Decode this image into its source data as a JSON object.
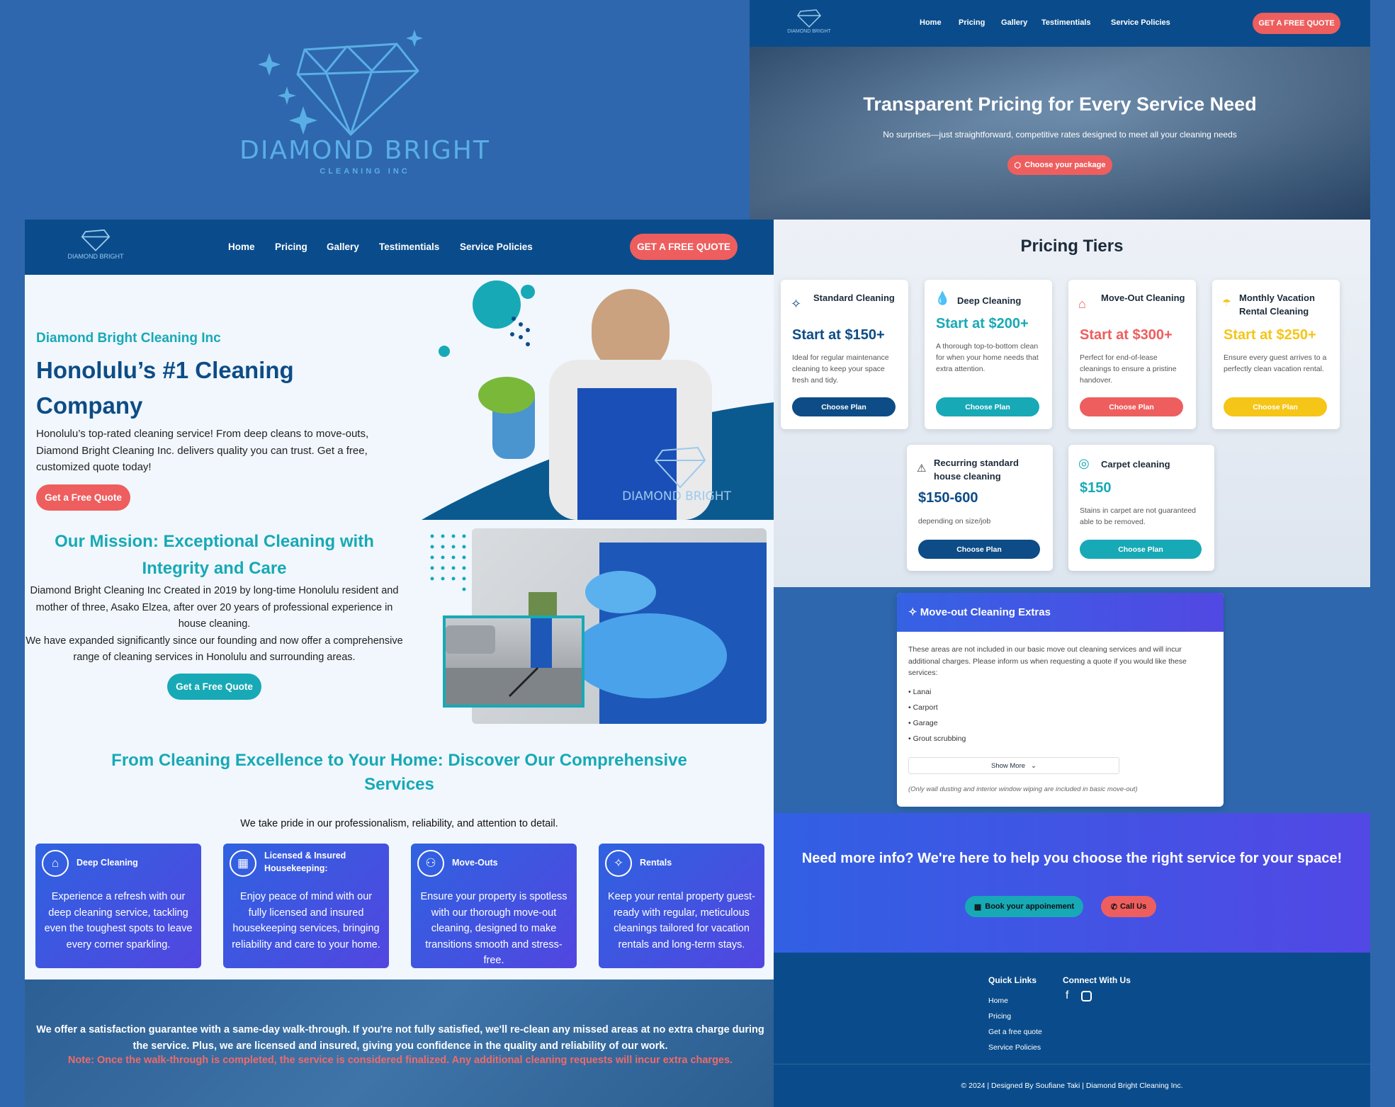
{
  "brand": {
    "name": "DIAMOND BRIGHT",
    "sub": "CLEANING INC"
  },
  "nav": {
    "items": [
      "Home",
      "Pricing",
      "Gallery",
      "Testimentials",
      "Service Policies"
    ],
    "cta": "GET A FREE QUOTE"
  },
  "pricing_hero": {
    "title": "Transparent Pricing for Every Service Need",
    "subtitle": "No surprises—just straightforward, competitive rates designed to meet all your cleaning needs",
    "button": "Choose your package"
  },
  "hero": {
    "eyebrow": "Diamond Bright Cleaning Inc",
    "title_line1": "Honolulu’s #1 Cleaning",
    "title_line2": "Company",
    "body": "Honolulu’s top-rated cleaning service! From deep cleans to move-outs, Diamond Bright Cleaning Inc. delivers quality you can trust. Get a free, customized quote today!",
    "button": "Get a Free Quote"
  },
  "mission": {
    "title": "Our Mission: Exceptional Cleaning with Integrity and Care",
    "p1": "Diamond Bright Cleaning Inc Created in 2019 by long-time Honolulu resident and mother of three, Asako Elzea, after over 20 years of professional experience in house cleaning.",
    "p2": "We have expanded significantly since our founding and now offer a comprehensive range of cleaning services in Honolulu and surrounding areas.",
    "button": "Get a Free Quote"
  },
  "services": {
    "title": "From Cleaning Excellence to Your Home: Discover Our Comprehensive Services",
    "subtitle": "We take pride in our professionalism, reliability, and attention to detail.",
    "cards": [
      {
        "title": "Deep Cleaning",
        "desc": "Experience a refresh with our deep cleaning service, tackling even the toughest spots to leave every corner sparkling.",
        "icon": "sparkle-house-icon"
      },
      {
        "title": "Licensed & Insured Housekeeping:",
        "desc": "Enjoy peace of mind with our fully licensed and insured housekeeping services, bringing reliability and care to your home.",
        "icon": "calendar-icon"
      },
      {
        "title": "Move-Outs",
        "desc": "Ensure your property is spotless with our thorough move-out cleaning, designed to make transitions smooth and stress-free.",
        "icon": "people-icon"
      },
      {
        "title": "Rentals",
        "desc": "Keep your rental property guest-ready with regular, meticulous cleanings tailored for vacation rentals and long-term stays.",
        "icon": "cleaning-icon"
      }
    ]
  },
  "guarantee": {
    "text": "We offer a satisfaction guarantee with a same-day walk-through. If you're not fully satisfied, we'll re-clean any missed areas at no extra charge during the service. Plus, we are licensed and insured, giving you confidence in the quality and reliability of our work.",
    "note": "Note: Once the walk-through is completed, the service is considered finalized. Any additional cleaning requests will incur extra charges."
  },
  "pricing": {
    "title": "Pricing Tiers",
    "button": "Choose Plan",
    "tiers": [
      {
        "title": "Standard Cleaning",
        "price": "Start at $150+",
        "desc": "Ideal for regular maintenance cleaning to keep your space fresh and tidy.",
        "color": "#0d4c86",
        "icon": "sparkle-icon"
      },
      {
        "title": "Deep Cleaning",
        "price": "Start at $200+",
        "desc": "A thorough top-to-bottom clean for when your home needs that extra attention.",
        "color": "#17a9b6",
        "icon": "droplets-icon"
      },
      {
        "title": "Move-Out Cleaning",
        "price": "Start at $300+",
        "desc": "Perfect for end-of-lease cleanings to ensure a pristine handover.",
        "color": "#ee5e5e",
        "icon": "house-icon"
      },
      {
        "title": "Monthly Vacation Rental Cleaning",
        "price": "Start at $250+",
        "desc": "Ensure every guest arrives to a perfectly clean vacation rental.",
        "color": "#f5c518",
        "icon": "umbrella-icon"
      },
      {
        "title": "Recurring standard house cleaning",
        "price": "$150-600",
        "desc": "depending on size/job",
        "color": "#0d4c86",
        "icon": "warning-icon"
      },
      {
        "title": "Carpet cleaning",
        "price": "$150",
        "desc": "Stains in carpet are not guaranteed able to be removed.",
        "color": "#17a9b6",
        "icon": "spiral-icon"
      }
    ]
  },
  "extras": {
    "title": "Move-out Cleaning Extras",
    "intro": "These areas are not included in our basic move out cleaning services and will incur additional charges. Please inform us when requesting a quote if you would like these services:",
    "items": [
      "Lanai",
      "Carport",
      "Garage",
      "Grout scrubbing"
    ],
    "show_more": "Show More",
    "footnote": "(Only wall dusting and interior window wiping are included in basic move-out)"
  },
  "cta": {
    "title": "Need more info? We're here to help you choose the right service for your space!",
    "book": "Book your appoinement",
    "call": "Call Us"
  },
  "footer": {
    "quick_links_title": "Quick Links",
    "quick_links": [
      "Home",
      "Pricing",
      "Get a free quote",
      "Service Policies"
    ],
    "connect_title": "Connect With Us",
    "copyright": "© 2024 | Designed By Soufiane Taki | Diamond Bright Cleaning Inc."
  },
  "colors": {
    "navy": "#0a4c8b",
    "teal": "#17a9b6",
    "coral": "#ee5e5e",
    "yellow": "#f5c518",
    "indigo": "#4f4be4"
  }
}
